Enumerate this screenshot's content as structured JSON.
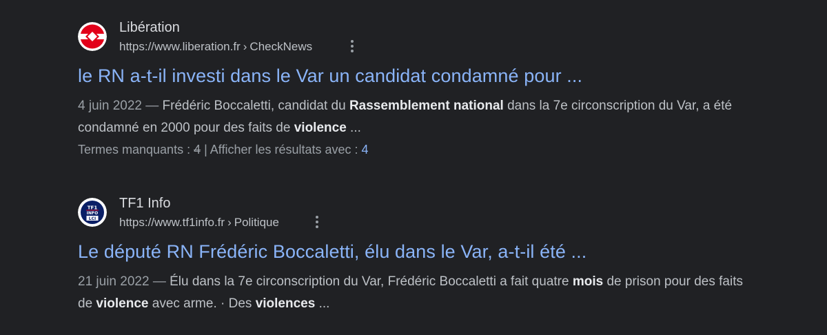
{
  "results": [
    {
      "site_name": "Libération",
      "url": "https://www.liberation.fr",
      "breadcrumb": "CheckNews",
      "breadcrumb_sep": "›",
      "title": "le RN a-t-il investi dans le Var un candidat condamné pour ...",
      "date": "4 juin 2022",
      "dash": " — ",
      "snippet_parts": [
        {
          "text": "Frédéric Boccaletti, candidat du ",
          "bold": false
        },
        {
          "text": "Rassemblement national",
          "bold": true
        },
        {
          "text": " dans la 7e circonscription du Var, a été condamné en 2000 pour des faits de ",
          "bold": false
        },
        {
          "text": "violence",
          "bold": true
        },
        {
          "text": " ...",
          "bold": false
        }
      ],
      "missing_label": "Termes manquants : ",
      "missing_term": "4",
      "separator": " | ",
      "show_with_label": "Afficher les résultats avec : ",
      "show_with_term": "4",
      "favicon": "liberation-logo",
      "favicon_colors": {
        "bg": "#ffffff",
        "mark": "#e2001a"
      }
    },
    {
      "site_name": "TF1 Info",
      "url": "https://www.tf1info.fr",
      "breadcrumb": "Politique",
      "breadcrumb_sep": "›",
      "title": "Le député RN Frédéric Boccaletti, élu dans le Var, a-t-il été ...",
      "date": "21 juin 2022",
      "dash": " — ",
      "snippet_parts": [
        {
          "text": "Élu dans la 7e circonscription du Var, Frédéric Boccaletti a fait quatre ",
          "bold": false
        },
        {
          "text": "mois",
          "bold": true
        },
        {
          "text": " de prison pour des faits de ",
          "bold": false
        },
        {
          "text": "violence",
          "bold": true
        },
        {
          "text": " avec arme. · Des ",
          "bold": false
        },
        {
          "text": "violences",
          "bold": true
        },
        {
          "text": " ...",
          "bold": false
        }
      ],
      "favicon": "tf1-info-lci-logo",
      "favicon_text": [
        "TF1",
        "INFO",
        "LCI"
      ],
      "favicon_colors": {
        "bg": "#ffffff",
        "badge": "#0a1f66",
        "accent": "#e2001a"
      }
    }
  ],
  "colors": {
    "background": "#202124",
    "link": "#8ab4f8",
    "text": "#bdc1c6"
  }
}
